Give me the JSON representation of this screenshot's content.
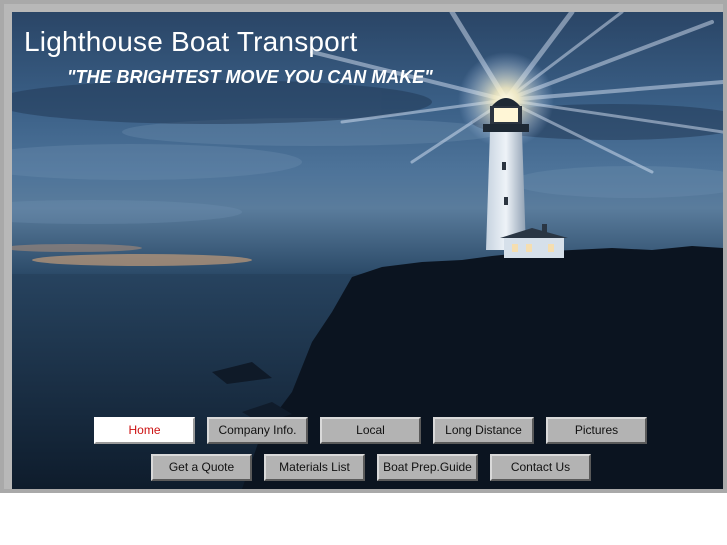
{
  "header": {
    "title": "Lighthouse Boat Transport",
    "tagline": "\"THE BRIGHTEST MOVE YOU CAN MAKE\""
  },
  "nav": {
    "row1": [
      {
        "label": "Home",
        "active": true
      },
      {
        "label": "Company Info."
      },
      {
        "label": "Local"
      },
      {
        "label": "Long Distance"
      },
      {
        "label": "Pictures"
      }
    ],
    "row2": [
      {
        "label": "Get a Quote"
      },
      {
        "label": "Materials List"
      },
      {
        "label": "Boat Prep.Guide"
      },
      {
        "label": "Contact Us"
      }
    ]
  },
  "colors": {
    "frame": "#a9a9a9",
    "sky": "#2f5073",
    "sea": "#162a40",
    "active_label": "#cc1111",
    "button": "#b3b3b3"
  }
}
